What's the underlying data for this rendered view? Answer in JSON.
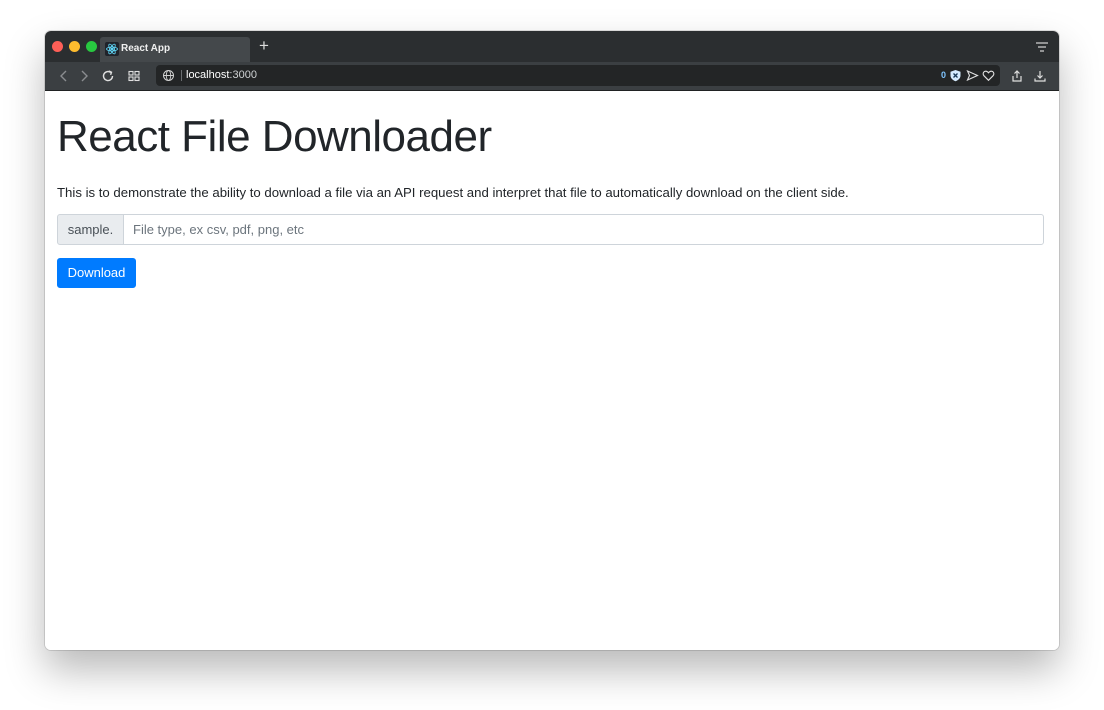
{
  "browser": {
    "tab_title": "React App",
    "url_host": "localhost",
    "url_port": ":3000",
    "blocked_count": "0",
    "accent_color": "#7fc4ff"
  },
  "page": {
    "title": "React File Downloader",
    "description": "This is to demonstrate the ability to download a file via an API request and interpret that file to automatically download on the client side.",
    "input_prefix": "sample.",
    "input_placeholder": "File type, ex csv, pdf, png, etc",
    "input_value": "",
    "download_label": "Download",
    "button_color": "#007bff"
  }
}
